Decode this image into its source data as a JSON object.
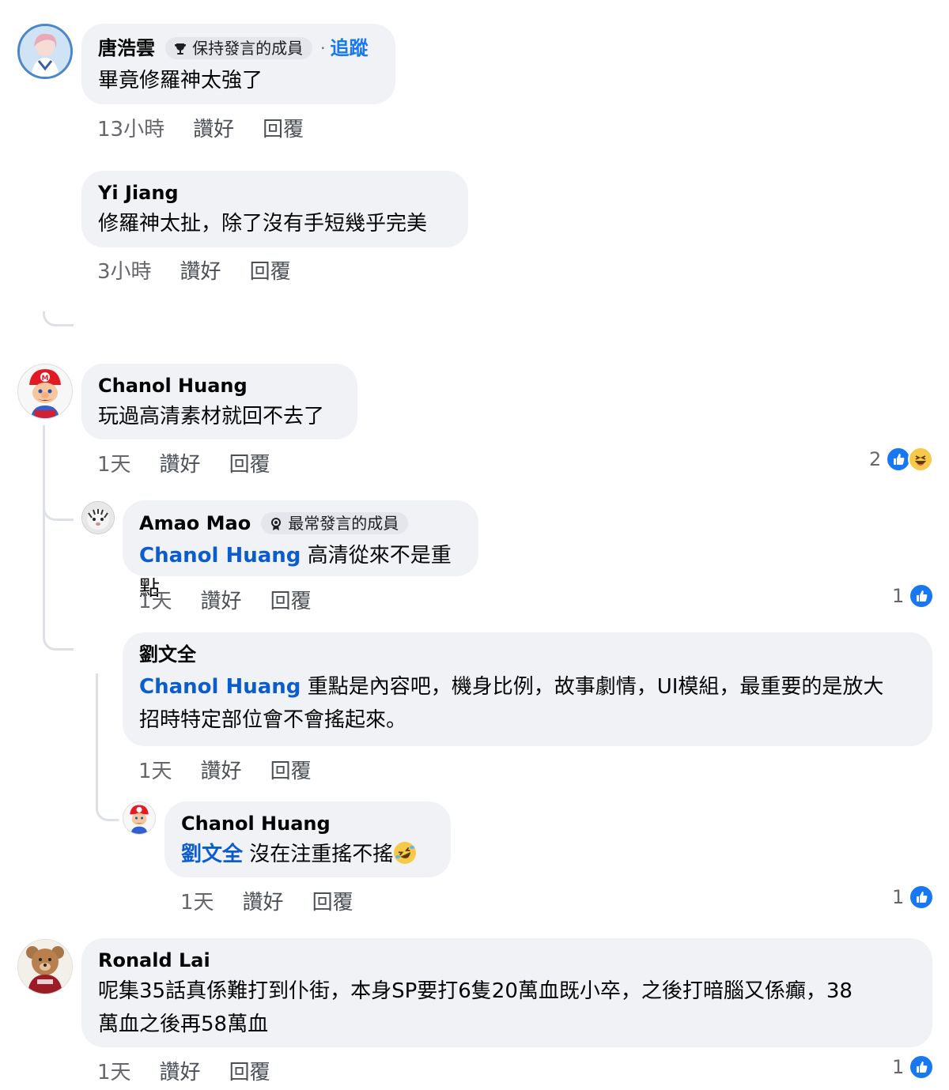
{
  "comments": [
    {
      "author": "唐浩雲",
      "badge": "保持發言的成員",
      "follow": "追蹤",
      "text": "畢竟修羅神太強了",
      "time": "13小時",
      "like_label": "讚好",
      "reply_label": "回覆",
      "avatar_icon": "anime-girl-avatar-icon"
    },
    {
      "author": "Yi Jiang",
      "text": "修羅神太扯，除了沒有手短幾乎完美",
      "time": "3小時",
      "like_label": "讚好",
      "reply_label": "回覆"
    },
    {
      "author": "Chanol Huang",
      "text": "玩過高清素材就回不去了",
      "time": "1天",
      "like_label": "讚好",
      "reply_label": "回覆",
      "reaction_count": "2",
      "reactions": [
        "like-icon",
        "haha-icon"
      ],
      "avatar_icon": "mario-avatar-icon"
    },
    {
      "author": "Amao Mao",
      "badge": "最常發言的成員",
      "mention": "Chanol Huang",
      "text": "高清從來不是重點",
      "time": "1天",
      "like_label": "讚好",
      "reply_label": "回覆",
      "reaction_count": "1",
      "reactions": [
        "like-icon"
      ],
      "avatar_icon": "tiger-avatar-icon"
    },
    {
      "author": "劉文全",
      "mention": "Chanol Huang",
      "text_line1": "重點是內容吧，機身比例，故事劇情，UI模組，最重要的是放大",
      "text_line2": "招時特定部位會不會搖起來。",
      "time": "1天",
      "like_label": "讚好",
      "reply_label": "回覆"
    },
    {
      "author": "Chanol Huang",
      "mention": "劉文全",
      "text": "沒在注重搖不搖",
      "emoji": "rolling-laughing-emoji",
      "time": "1天",
      "like_label": "讚好",
      "reply_label": "回覆",
      "reaction_count": "1",
      "reactions": [
        "like-icon"
      ],
      "avatar_icon": "mario-avatar-icon"
    },
    {
      "author": "Ronald Lai",
      "text_line1": "呢集35話真係難打到仆街，本身SP要打6隻20萬血既小卒，之後打暗腦又係癲，38",
      "text_line2": "萬血之後再58萬血",
      "time": "1天",
      "like_label": "讚好",
      "reply_label": "回覆",
      "reaction_count": "1",
      "reactions": [
        "like-icon"
      ],
      "avatar_icon": "teddy-bear-avatar-icon"
    }
  ],
  "colors": {
    "bubble": "#f0f2f5",
    "mention": "#0b5ccf",
    "like": "#1877f2",
    "meta": "#65676b"
  }
}
